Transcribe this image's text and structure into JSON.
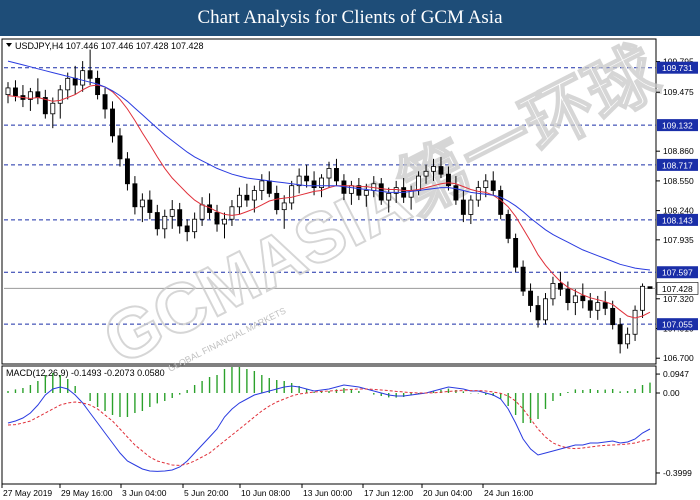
{
  "banner": {
    "title": "Chart Analysis for Clients of GCM Asia"
  },
  "watermark": {
    "text": "GCMASIA第一环球",
    "small": "GLOBAL FINANCIAL MARKETS"
  },
  "chart_data": [
    {
      "type": "candlestick",
      "title": "USDJPY,H4 107.446 107.446 107.428 107.428",
      "symbol": "USDJPY",
      "timeframe": "H4",
      "ohlc": {
        "open": 107.446,
        "high": 107.446,
        "low": 107.428,
        "close": 107.428
      },
      "ylim": [
        106.65,
        110.02
      ],
      "y_ticks": [
        "109.795",
        "109.475",
        "108.860",
        "108.550",
        "108.240",
        "107.935",
        "107.320",
        "107.010",
        "106.700"
      ],
      "levels": [
        {
          "value": 109.731,
          "label": "109.731",
          "color": "#1a2ea8"
        },
        {
          "value": 109.132,
          "label": "109.132",
          "color": "#1a2ea8"
        },
        {
          "value": 108.717,
          "label": "108.717",
          "color": "#1a2ea8"
        },
        {
          "value": 108.143,
          "label": "108.143",
          "color": "#1a2ea8"
        },
        {
          "value": 107.597,
          "label": "107.597",
          "color": "#1a2ea8"
        },
        {
          "value": 107.055,
          "label": "107.055",
          "color": "#1a2ea8"
        }
      ],
      "current_price": {
        "value": 107.428,
        "label": "107.428"
      },
      "x_labels": [
        "27 May 2019",
        "29 May 16:00",
        "3 Jun 04:00",
        "5 Jun 20:00",
        "10 Jun 08:00",
        "13 Jun 00:00",
        "17 Jun 12:00",
        "20 Jun 04:00",
        "24 Jun 16:00"
      ],
      "candles": [
        [
          109.45,
          109.58,
          109.36,
          109.52
        ],
        [
          109.52,
          109.6,
          109.38,
          109.44
        ],
        [
          109.44,
          109.55,
          109.32,
          109.4
        ],
        [
          109.4,
          109.52,
          109.28,
          109.48
        ],
        [
          109.48,
          109.62,
          109.35,
          109.42
        ],
        [
          109.42,
          109.5,
          109.2,
          109.25
        ],
        [
          109.25,
          109.42,
          109.1,
          109.36
        ],
        [
          109.36,
          109.55,
          109.2,
          109.5
        ],
        [
          109.5,
          109.68,
          109.4,
          109.62
        ],
        [
          109.62,
          109.75,
          109.45,
          109.55
        ],
        [
          109.55,
          109.8,
          109.48,
          109.7
        ],
        [
          109.7,
          109.92,
          109.55,
          109.62
        ],
        [
          109.62,
          109.7,
          109.4,
          109.45
        ],
        [
          109.45,
          109.52,
          109.2,
          109.3
        ],
        [
          109.3,
          109.38,
          108.95,
          109.02
        ],
        [
          109.02,
          109.1,
          108.7,
          108.78
        ],
        [
          108.78,
          108.85,
          108.45,
          108.52
        ],
        [
          108.52,
          108.6,
          108.2,
          108.28
        ],
        [
          108.28,
          108.42,
          108.12,
          108.35
        ],
        [
          108.35,
          108.45,
          108.15,
          108.22
        ],
        [
          108.22,
          108.3,
          107.98,
          108.05
        ],
        [
          108.05,
          108.25,
          107.95,
          108.18
        ],
        [
          108.18,
          108.35,
          108.05,
          108.25
        ],
        [
          108.25,
          108.32,
          108.0,
          108.08
        ],
        [
          108.08,
          108.15,
          107.92,
          108.02
        ],
        [
          108.02,
          108.22,
          107.95,
          108.15
        ],
        [
          108.15,
          108.38,
          108.08,
          108.3
        ],
        [
          108.3,
          108.42,
          108.15,
          108.22
        ],
        [
          108.22,
          108.3,
          108.02,
          108.1
        ],
        [
          108.1,
          108.22,
          107.95,
          108.15
        ],
        [
          108.15,
          108.35,
          108.08,
          108.28
        ],
        [
          108.28,
          108.48,
          108.2,
          108.4
        ],
        [
          108.4,
          108.52,
          108.28,
          108.35
        ],
        [
          108.35,
          108.5,
          108.22,
          108.45
        ],
        [
          108.45,
          108.62,
          108.35,
          108.55
        ],
        [
          108.55,
          108.65,
          108.38,
          108.42
        ],
        [
          108.42,
          108.5,
          108.2,
          108.25
        ],
        [
          108.25,
          108.4,
          108.05,
          108.32
        ],
        [
          108.32,
          108.55,
          108.25,
          108.5
        ],
        [
          108.5,
          108.68,
          108.42,
          108.6
        ],
        [
          108.6,
          108.72,
          108.48,
          108.55
        ],
        [
          108.55,
          108.65,
          108.4,
          108.48
        ],
        [
          108.48,
          108.62,
          108.38,
          108.58
        ],
        [
          108.58,
          108.75,
          108.48,
          108.68
        ],
        [
          108.68,
          108.78,
          108.5,
          108.55
        ],
        [
          108.55,
          108.62,
          108.35,
          108.42
        ],
        [
          108.42,
          108.55,
          108.3,
          108.5
        ],
        [
          108.5,
          108.58,
          108.35,
          108.4
        ],
        [
          108.4,
          108.52,
          108.28,
          108.45
        ],
        [
          108.45,
          108.6,
          108.38,
          108.52
        ],
        [
          108.52,
          108.58,
          108.3,
          108.35
        ],
        [
          108.35,
          108.48,
          108.22,
          108.42
        ],
        [
          108.42,
          108.55,
          108.32,
          108.48
        ],
        [
          108.48,
          108.58,
          108.32,
          108.38
        ],
        [
          108.38,
          108.5,
          108.25,
          108.45
        ],
        [
          108.45,
          108.65,
          108.4,
          108.6
        ],
        [
          108.6,
          108.72,
          108.52,
          108.65
        ],
        [
          108.65,
          108.78,
          108.55,
          108.7
        ],
        [
          108.7,
          108.8,
          108.58,
          108.62
        ],
        [
          108.62,
          108.7,
          108.45,
          108.5
        ],
        [
          108.5,
          108.6,
          108.3,
          108.35
        ],
        [
          108.35,
          108.45,
          108.12,
          108.2
        ],
        [
          108.2,
          108.4,
          108.1,
          108.35
        ],
        [
          108.35,
          108.55,
          108.28,
          108.48
        ],
        [
          108.48,
          108.62,
          108.38,
          108.55
        ],
        [
          108.55,
          108.65,
          108.4,
          108.45
        ],
        [
          108.45,
          108.5,
          108.15,
          108.2
        ],
        [
          108.2,
          108.25,
          107.9,
          107.95
        ],
        [
          107.95,
          108.0,
          107.6,
          107.65
        ],
        [
          107.65,
          107.72,
          107.35,
          107.4
        ],
        [
          107.4,
          107.48,
          107.18,
          107.25
        ],
        [
          107.25,
          107.35,
          107.02,
          107.1
        ],
        [
          107.1,
          107.38,
          107.05,
          107.32
        ],
        [
          107.32,
          107.55,
          107.25,
          107.48
        ],
        [
          107.48,
          107.6,
          107.35,
          107.42
        ],
        [
          107.42,
          107.5,
          107.2,
          107.28
        ],
        [
          107.28,
          107.42,
          107.15,
          107.35
        ],
        [
          107.35,
          107.48,
          107.22,
          107.3
        ],
        [
          107.3,
          107.38,
          107.12,
          107.2
        ],
        [
          107.2,
          107.35,
          107.1,
          107.28
        ],
        [
          107.28,
          107.4,
          107.15,
          107.22
        ],
        [
          107.22,
          107.3,
          107.0,
          107.05
        ],
        [
          107.05,
          107.12,
          106.75,
          106.85
        ],
        [
          106.85,
          107.02,
          106.8,
          106.95
        ],
        [
          106.95,
          107.25,
          106.88,
          107.2
        ],
        [
          107.2,
          107.48,
          107.12,
          107.45
        ],
        [
          107.446,
          107.446,
          107.428,
          107.428
        ]
      ],
      "series": [
        {
          "name": "fast MA",
          "color": "#e0303a",
          "values": [
            109.44,
            109.43,
            109.42,
            109.41,
            109.42,
            109.4,
            109.38,
            109.39,
            109.42,
            109.45,
            109.5,
            109.54,
            109.55,
            109.53,
            109.48,
            109.4,
            109.3,
            109.18,
            109.05,
            108.93,
            108.8,
            108.68,
            108.58,
            108.5,
            108.42,
            108.35,
            108.3,
            108.27,
            108.23,
            108.2,
            108.19,
            108.2,
            108.23,
            108.26,
            108.3,
            108.34,
            108.36,
            108.37,
            108.38,
            108.4,
            108.42,
            108.44,
            108.45,
            108.48,
            108.5,
            108.5,
            108.5,
            108.49,
            108.49,
            108.48,
            108.47,
            108.46,
            108.46,
            108.45,
            108.45,
            108.46,
            108.48,
            108.5,
            108.52,
            108.53,
            108.52,
            108.49,
            108.46,
            108.44,
            108.43,
            108.4,
            108.35,
            108.28,
            108.18,
            108.05,
            107.92,
            107.78,
            107.67,
            107.58,
            107.5,
            107.44,
            107.4,
            107.36,
            107.33,
            107.31,
            107.29,
            107.26,
            107.2,
            107.14,
            107.12,
            107.14,
            107.18
          ]
        },
        {
          "name": "slow MA",
          "color": "#2a3be0",
          "values": [
            109.8,
            109.78,
            109.76,
            109.74,
            109.72,
            109.7,
            109.68,
            109.66,
            109.64,
            109.62,
            109.6,
            109.58,
            109.56,
            109.53,
            109.49,
            109.44,
            109.38,
            109.31,
            109.24,
            109.17,
            109.1,
            109.03,
            108.97,
            108.91,
            108.85,
            108.8,
            108.76,
            108.72,
            108.68,
            108.65,
            108.62,
            108.6,
            108.58,
            108.57,
            108.56,
            108.55,
            108.54,
            108.53,
            108.52,
            108.51,
            108.5,
            108.5,
            108.5,
            108.5,
            108.5,
            108.49,
            108.48,
            108.47,
            108.46,
            108.45,
            108.44,
            108.43,
            108.43,
            108.43,
            108.44,
            108.45,
            108.46,
            108.47,
            108.48,
            108.48,
            108.47,
            108.45,
            108.43,
            108.42,
            108.41,
            108.4,
            108.38,
            108.34,
            108.29,
            108.23,
            108.16,
            108.1,
            108.04,
            107.99,
            107.95,
            107.91,
            107.87,
            107.83,
            107.8,
            107.77,
            107.74,
            107.71,
            107.68,
            107.66,
            107.64,
            107.63,
            107.62
          ]
        }
      ]
    },
    {
      "type": "bar",
      "title": "MACD(12,26,9) -0.1493 -0.2073 0.0580",
      "indicator": "MACD",
      "params": [
        12,
        26,
        9
      ],
      "readout": {
        "macd": -0.1493,
        "signal": -0.2073,
        "histogram": 0.058
      },
      "ylim": [
        -0.45,
        0.13
      ],
      "y_ticks": [
        "0.0947",
        "0.00",
        "-0.3999"
      ],
      "series": [
        {
          "name": "MACD",
          "color": "#2a3be0",
          "values": [
            -0.15,
            -0.14,
            -0.125,
            -0.1,
            -0.06,
            -0.01,
            0.02,
            0.03,
            0.02,
            -0.01,
            -0.05,
            -0.1,
            -0.15,
            -0.2,
            -0.25,
            -0.3,
            -0.34,
            -0.36,
            -0.38,
            -0.39,
            -0.392,
            -0.39,
            -0.385,
            -0.37,
            -0.34,
            -0.3,
            -0.26,
            -0.22,
            -0.18,
            -0.12,
            -0.08,
            -0.05,
            -0.03,
            -0.01,
            0.0,
            0.01,
            0.02,
            0.03,
            0.035,
            0.03,
            0.02,
            0.01,
            0.015,
            0.02,
            0.03,
            0.04,
            0.035,
            0.03,
            0.02,
            0.01,
            0.0,
            -0.01,
            -0.015,
            -0.015,
            -0.01,
            -0.005,
            0.0,
            0.01,
            0.02,
            0.03,
            0.025,
            0.02,
            0.01,
            0.01,
            0.0,
            -0.01,
            -0.03,
            -0.08,
            -0.15,
            -0.23,
            -0.28,
            -0.31,
            -0.3,
            -0.29,
            -0.28,
            -0.27,
            -0.26,
            -0.26,
            -0.25,
            -0.25,
            -0.245,
            -0.24,
            -0.25,
            -0.245,
            -0.23,
            -0.2,
            -0.18
          ]
        },
        {
          "name": "Signal",
          "color": "#e0303a",
          "values": [
            -0.16,
            -0.158,
            -0.15,
            -0.14,
            -0.12,
            -0.1,
            -0.08,
            -0.06,
            -0.05,
            -0.045,
            -0.05,
            -0.06,
            -0.08,
            -0.11,
            -0.14,
            -0.18,
            -0.22,
            -0.26,
            -0.29,
            -0.32,
            -0.34,
            -0.35,
            -0.36,
            -0.362,
            -0.355,
            -0.34,
            -0.32,
            -0.3,
            -0.27,
            -0.24,
            -0.21,
            -0.18,
            -0.15,
            -0.12,
            -0.09,
            -0.065,
            -0.045,
            -0.03,
            -0.015,
            -0.005,
            0.0,
            0.005,
            0.008,
            0.01,
            0.012,
            0.015,
            0.018,
            0.02,
            0.02,
            0.018,
            0.015,
            0.012,
            0.008,
            0.005,
            0.002,
            0.0,
            0.0,
            0.001,
            0.004,
            0.008,
            0.01,
            0.012,
            0.012,
            0.012,
            0.01,
            0.005,
            -0.002,
            -0.015,
            -0.04,
            -0.08,
            -0.13,
            -0.18,
            -0.22,
            -0.25,
            -0.265,
            -0.275,
            -0.278,
            -0.275,
            -0.27,
            -0.265,
            -0.262,
            -0.26,
            -0.258,
            -0.255,
            -0.25,
            -0.24,
            -0.232
          ]
        }
      ]
    }
  ]
}
